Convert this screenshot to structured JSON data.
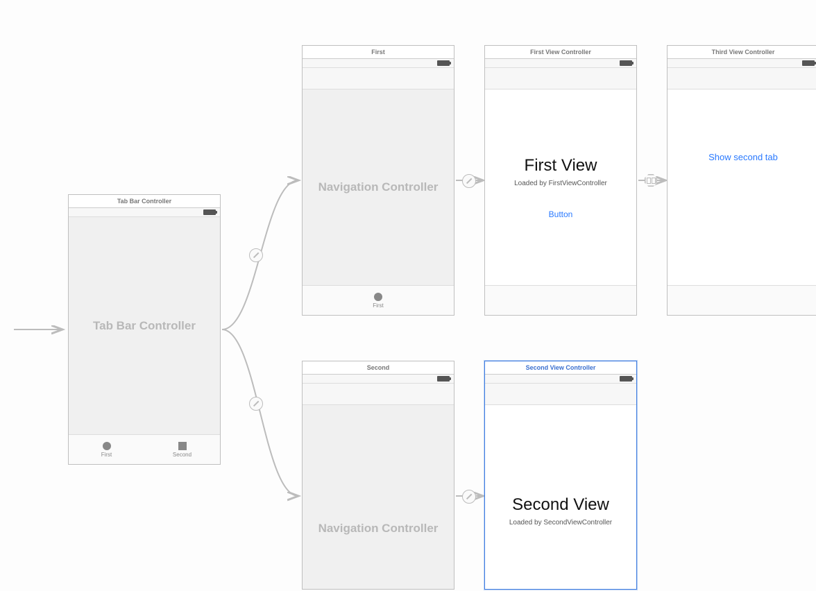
{
  "tabBarController": {
    "title": "Tab Bar Controller",
    "placeholder": "Tab Bar Controller",
    "tabs": [
      {
        "label": "First",
        "icon": "circle"
      },
      {
        "label": "Second",
        "icon": "square"
      }
    ]
  },
  "navFirst": {
    "title": "First",
    "placeholder": "Navigation Controller",
    "tabLabel": "First"
  },
  "navSecond": {
    "title": "Second",
    "placeholder": "Navigation Controller"
  },
  "firstVC": {
    "title": "First View Controller",
    "heading": "First View",
    "subtitle": "Loaded by FirstViewController",
    "buttonLabel": "Button"
  },
  "secondVC": {
    "title": "Second View Controller",
    "heading": "Second View",
    "subtitle": "Loaded by SecondViewController"
  },
  "thirdVC": {
    "title": "Third View Controller",
    "buttonLabel": "Show second tab"
  }
}
